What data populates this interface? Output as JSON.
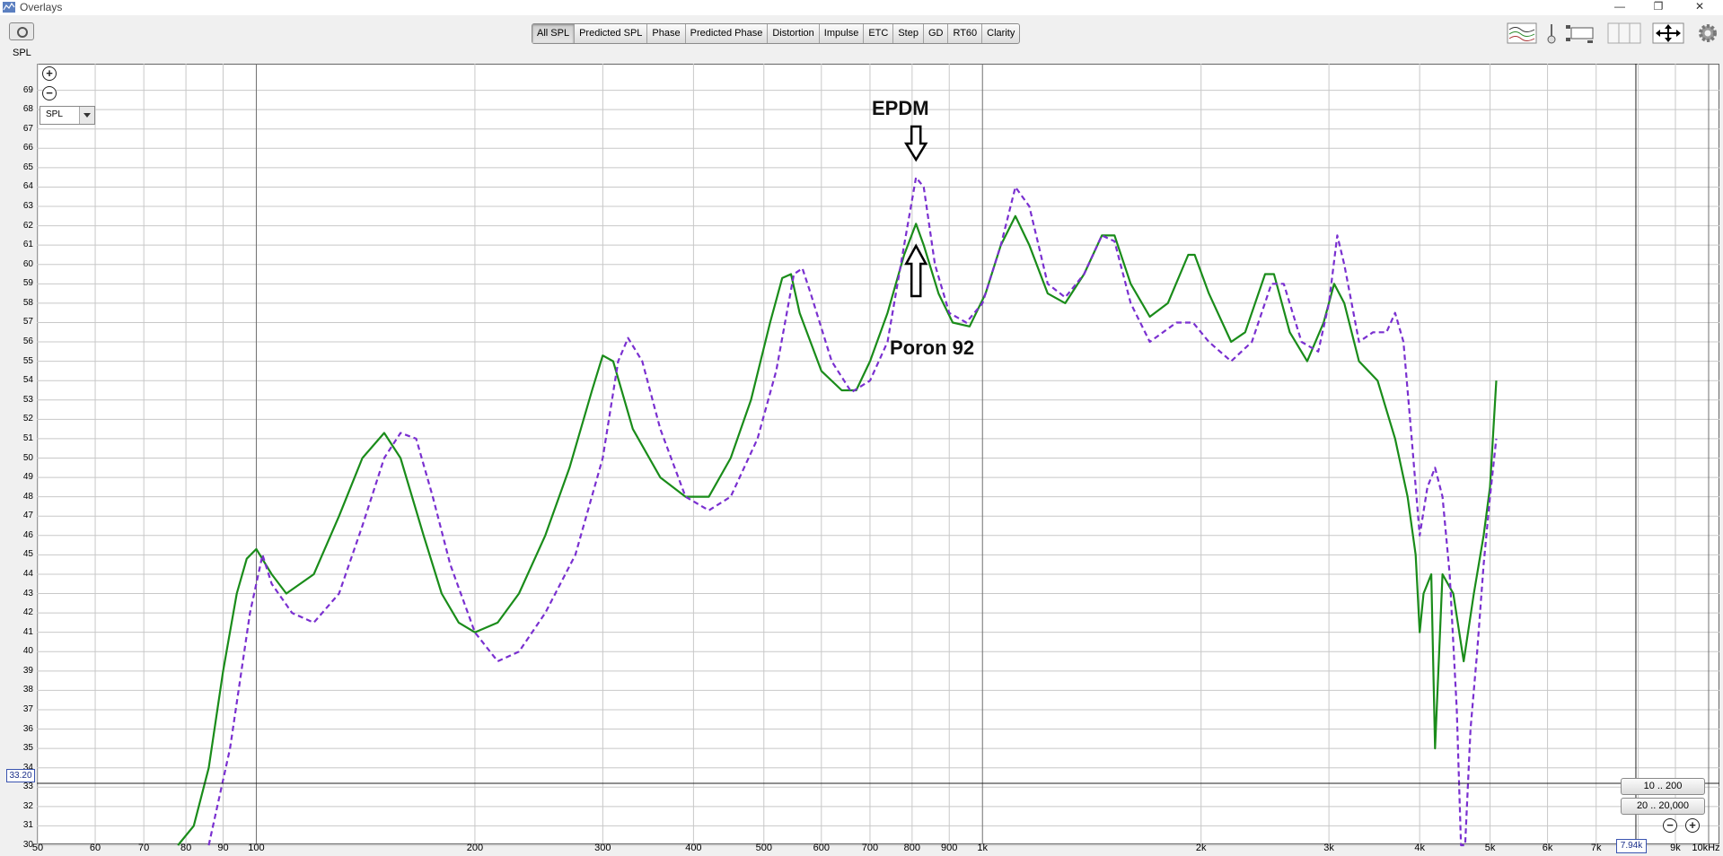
{
  "window": {
    "title": "Overlays",
    "buttons": [
      "—",
      "❐",
      "✕"
    ]
  },
  "toolbar": {
    "camera_icon": "camera-icon",
    "axis_label": "SPL",
    "tabs": [
      "All SPL",
      "Predicted SPL",
      "Phase",
      "Predicted Phase",
      "Distortion",
      "Impulse",
      "ETC",
      "Step",
      "GD",
      "RT60",
      "Clarity"
    ],
    "active_tab": "All SPL",
    "right_icons": [
      "trace-arrange-icon",
      "slider-icon",
      "legend-position-icon",
      "panel-layout-icon",
      "fit-view-icon",
      "settings-gear-icon"
    ]
  },
  "plot_controls": {
    "zoom_in": "+",
    "zoom_out": "−",
    "dropdown_value": "SPL"
  },
  "cursor": {
    "y_readout": "33.20",
    "x_readout": "7.94k",
    "y_value": 33.2,
    "x_value": 7940
  },
  "range_buttons": [
    "10 .. 200",
    "20 .. 20,000"
  ],
  "annotations": {
    "upper": "EPDM",
    "lower": "Poron 92"
  },
  "colors": {
    "green": "#1a8c1a",
    "purple": "#7a30d0",
    "grid": "#c8c8c8",
    "major_grid": "#707070"
  },
  "chart_data": {
    "type": "line",
    "xscale": "log",
    "xlim": [
      50,
      10000
    ],
    "ylim": [
      30,
      70
    ],
    "ylabel": "SPL",
    "grid": true,
    "y_ticks": [
      30,
      31,
      32,
      33,
      34,
      35,
      36,
      37,
      38,
      39,
      40,
      41,
      42,
      43,
      44,
      45,
      46,
      47,
      48,
      49,
      50,
      51,
      52,
      53,
      54,
      55,
      56,
      57,
      58,
      59,
      60,
      61,
      62,
      63,
      64,
      65,
      66,
      67,
      68,
      69
    ],
    "x_ticks": [
      {
        "v": 50,
        "label": "50"
      },
      {
        "v": 60,
        "label": "60"
      },
      {
        "v": 70,
        "label": "70"
      },
      {
        "v": 80,
        "label": "80"
      },
      {
        "v": 90,
        "label": "90"
      },
      {
        "v": 100,
        "label": "100"
      },
      {
        "v": 200,
        "label": "200"
      },
      {
        "v": 300,
        "label": "300"
      },
      {
        "v": 400,
        "label": "400"
      },
      {
        "v": 500,
        "label": "500"
      },
      {
        "v": 600,
        "label": "600"
      },
      {
        "v": 700,
        "label": "700"
      },
      {
        "v": 800,
        "label": "800"
      },
      {
        "v": 900,
        "label": "900"
      },
      {
        "v": 1000,
        "label": "1k"
      },
      {
        "v": 2000,
        "label": "2k"
      },
      {
        "v": 3000,
        "label": "3k"
      },
      {
        "v": 4000,
        "label": "4k"
      },
      {
        "v": 5000,
        "label": "5k"
      },
      {
        "v": 6000,
        "label": "6k"
      },
      {
        "v": 7000,
        "label": "7k"
      },
      {
        "v": 9000,
        "label": "9k"
      },
      {
        "v": 10000,
        "label": "10kHz"
      }
    ],
    "series": [
      {
        "color": "#1a8c1a",
        "style": "solid",
        "points": [
          [
            78,
            30
          ],
          [
            82,
            31
          ],
          [
            86,
            34
          ],
          [
            90,
            39
          ],
          [
            94,
            43
          ],
          [
            97,
            44.8
          ],
          [
            100,
            45.3
          ],
          [
            105,
            44
          ],
          [
            110,
            43
          ],
          [
            120,
            44
          ],
          [
            130,
            47
          ],
          [
            140,
            50
          ],
          [
            150,
            51.3
          ],
          [
            158,
            50
          ],
          [
            170,
            46
          ],
          [
            180,
            43
          ],
          [
            190,
            41.5
          ],
          [
            200,
            41
          ],
          [
            215,
            41.5
          ],
          [
            230,
            43
          ],
          [
            250,
            46
          ],
          [
            270,
            49.5
          ],
          [
            290,
            53.5
          ],
          [
            300,
            55.3
          ],
          [
            310,
            55
          ],
          [
            330,
            51.5
          ],
          [
            360,
            49
          ],
          [
            390,
            48
          ],
          [
            420,
            48
          ],
          [
            450,
            50
          ],
          [
            480,
            53
          ],
          [
            510,
            57
          ],
          [
            530,
            59.3
          ],
          [
            545,
            59.5
          ],
          [
            560,
            57.5
          ],
          [
            600,
            54.5
          ],
          [
            640,
            53.5
          ],
          [
            670,
            53.5
          ],
          [
            700,
            55
          ],
          [
            740,
            57.5
          ],
          [
            780,
            60.5
          ],
          [
            810,
            62.1
          ],
          [
            830,
            61
          ],
          [
            870,
            58.5
          ],
          [
            910,
            57
          ],
          [
            960,
            56.8
          ],
          [
            1010,
            58.5
          ],
          [
            1060,
            61
          ],
          [
            1110,
            62.5
          ],
          [
            1160,
            61
          ],
          [
            1230,
            58.5
          ],
          [
            1300,
            58
          ],
          [
            1380,
            59.5
          ],
          [
            1460,
            61.5
          ],
          [
            1520,
            61.5
          ],
          [
            1600,
            59
          ],
          [
            1700,
            57.3
          ],
          [
            1800,
            58
          ],
          [
            1920,
            60.5
          ],
          [
            1960,
            60.5
          ],
          [
            2050,
            58.5
          ],
          [
            2200,
            56
          ],
          [
            2300,
            56.5
          ],
          [
            2450,
            59.5
          ],
          [
            2520,
            59.5
          ],
          [
            2650,
            56.5
          ],
          [
            2800,
            55
          ],
          [
            2950,
            57
          ],
          [
            3050,
            59
          ],
          [
            3150,
            58
          ],
          [
            3300,
            55
          ],
          [
            3500,
            54
          ],
          [
            3700,
            51
          ],
          [
            3850,
            48
          ],
          [
            3950,
            45
          ],
          [
            4000,
            41
          ],
          [
            4050,
            43
          ],
          [
            4150,
            44
          ],
          [
            4200,
            35
          ],
          [
            4300,
            44
          ],
          [
            4450,
            43
          ],
          [
            4600,
            39.5
          ],
          [
            4750,
            43
          ],
          [
            4900,
            46
          ],
          [
            5000,
            48.5
          ],
          [
            5100,
            54
          ]
        ]
      },
      {
        "color": "#7a30d0",
        "style": "dashed",
        "points": [
          [
            86,
            30
          ],
          [
            92,
            35
          ],
          [
            98,
            42
          ],
          [
            102,
            45
          ],
          [
            105,
            43.5
          ],
          [
            112,
            42
          ],
          [
            120,
            41.5
          ],
          [
            130,
            43
          ],
          [
            140,
            46.5
          ],
          [
            150,
            50
          ],
          [
            158,
            51.3
          ],
          [
            166,
            51
          ],
          [
            175,
            48
          ],
          [
            185,
            44.5
          ],
          [
            200,
            41
          ],
          [
            215,
            39.5
          ],
          [
            230,
            40
          ],
          [
            250,
            42
          ],
          [
            275,
            45
          ],
          [
            300,
            50
          ],
          [
            315,
            55
          ],
          [
            325,
            56.2
          ],
          [
            340,
            55
          ],
          [
            360,
            51.5
          ],
          [
            390,
            48
          ],
          [
            420,
            47.3
          ],
          [
            450,
            48
          ],
          [
            490,
            51
          ],
          [
            520,
            54.5
          ],
          [
            550,
            59.5
          ],
          [
            565,
            59.8
          ],
          [
            580,
            58.5
          ],
          [
            620,
            55
          ],
          [
            660,
            53.4
          ],
          [
            700,
            54
          ],
          [
            740,
            56
          ],
          [
            780,
            61
          ],
          [
            810,
            64.5
          ],
          [
            830,
            64
          ],
          [
            860,
            60
          ],
          [
            900,
            57.5
          ],
          [
            950,
            57
          ],
          [
            1000,
            58
          ],
          [
            1060,
            61
          ],
          [
            1110,
            64
          ],
          [
            1160,
            63
          ],
          [
            1230,
            59
          ],
          [
            1300,
            58.3
          ],
          [
            1380,
            59.5
          ],
          [
            1460,
            61.5
          ],
          [
            1520,
            61.2
          ],
          [
            1600,
            58
          ],
          [
            1700,
            56
          ],
          [
            1850,
            57
          ],
          [
            1950,
            57
          ],
          [
            2050,
            56
          ],
          [
            2200,
            55
          ],
          [
            2350,
            56
          ],
          [
            2500,
            59
          ],
          [
            2600,
            59
          ],
          [
            2750,
            56
          ],
          [
            2900,
            55.5
          ],
          [
            3000,
            58
          ],
          [
            3080,
            61.5
          ],
          [
            3150,
            60
          ],
          [
            3300,
            56
          ],
          [
            3450,
            56.5
          ],
          [
            3600,
            56.5
          ],
          [
            3700,
            57.5
          ],
          [
            3800,
            56
          ],
          [
            3900,
            51
          ],
          [
            4000,
            46
          ],
          [
            4100,
            48.5
          ],
          [
            4200,
            49.5
          ],
          [
            4300,
            48
          ],
          [
            4400,
            44
          ],
          [
            4500,
            37
          ],
          [
            4560,
            30
          ],
          [
            4620,
            30
          ],
          [
            4700,
            36
          ],
          [
            4800,
            40
          ],
          [
            4900,
            44.5
          ],
          [
            5000,
            48
          ],
          [
            5100,
            51
          ]
        ]
      }
    ]
  }
}
